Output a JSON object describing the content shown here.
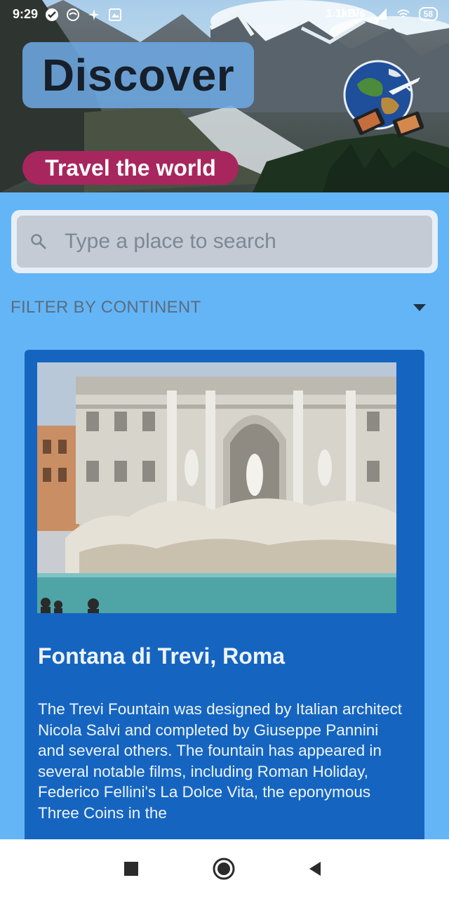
{
  "status_bar": {
    "time": "9:29",
    "network_speed": "1.1kB/s",
    "battery": "58"
  },
  "header": {
    "title": "Discover",
    "subtitle": "Travel the world",
    "logo_icon": "globe-airplane-film-logo-icon"
  },
  "search": {
    "placeholder": "Type a place to search",
    "value": "",
    "icon": "search-icon"
  },
  "filter": {
    "label": "FILTER BY CONTINENT",
    "icon": "dropdown-caret-icon"
  },
  "places": [
    {
      "title": "Fontana di Trevi, Roma",
      "description": "The Trevi Fountain was designed by Italian architect Nicola Salvi and completed by Giuseppe Pannini and several others. The fountain has appeared in several notable films, including Roman Holiday, Federico Fellini's La Dolce Vita, the eponymous Three Coins in the"
    }
  ],
  "nav_bar": {
    "recents_icon": "square-recents-icon",
    "home_icon": "circle-home-icon",
    "back_icon": "triangle-back-icon"
  },
  "colors": {
    "background": "#64b5f6",
    "card": "#1565c0",
    "title_box": "#6eaae6",
    "subtitle_pill": "#a8265e"
  }
}
